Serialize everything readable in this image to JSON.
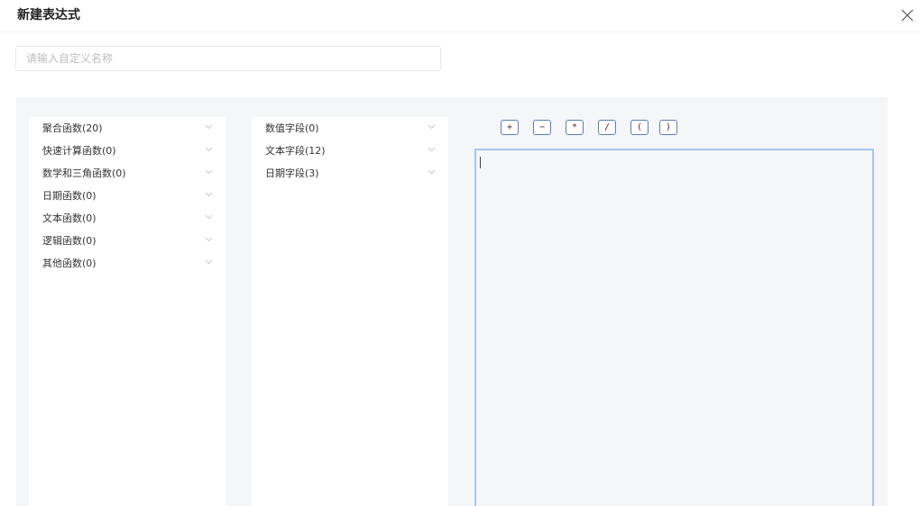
{
  "dialog": {
    "title": "新建表达式",
    "name_placeholder": "请输入自定义名称",
    "name_value": ""
  },
  "function_categories": [
    {
      "label": "聚合函数(20)"
    },
    {
      "label": "快速计算函数(0)"
    },
    {
      "label": "数学和三角函数(0)"
    },
    {
      "label": "日期函数(0)"
    },
    {
      "label": "文本函数(0)"
    },
    {
      "label": "逻辑函数(0)"
    },
    {
      "label": "其他函数(0)"
    }
  ],
  "field_categories": [
    {
      "label": "数值字段(0)"
    },
    {
      "label": "文本字段(12)"
    },
    {
      "label": "日期字段(3)"
    }
  ],
  "operators": [
    "+",
    "−",
    "*",
    "/",
    "(",
    ")"
  ],
  "icons": {
    "close": "close-icon",
    "chevron": "chevron-down-icon"
  },
  "colors": {
    "workspace_bg": "#f5f6f8",
    "editor_border": "#a8c6ec",
    "operator_border": "#5b7fb0"
  }
}
